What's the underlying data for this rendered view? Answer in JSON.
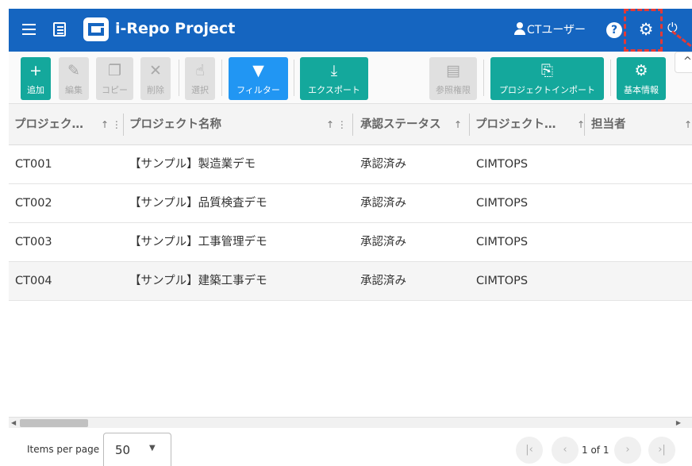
{
  "header": {
    "app_title": "i-Repo Project",
    "user_name": "CTユーザー",
    "help_label": "?",
    "colors": {
      "header_bg": "#1565c0",
      "highlight": "#e53935"
    }
  },
  "toolbar": {
    "add": "追加",
    "edit": "編集",
    "copy": "コピー",
    "delete": "削除",
    "select": "選択",
    "filter": "フィルター",
    "export": "エクスポート",
    "permissions": "参照権限",
    "project_import": "プロジェクトインポート",
    "basic_info": "基本情報",
    "colors": {
      "teal": "#14a89c",
      "blue": "#2196f3",
      "disabled": "#e0e0e0"
    }
  },
  "table": {
    "columns": [
      "プロジェク…",
      "プロジェクト名称",
      "承認ステータス",
      "プロジェクト…",
      "担当者"
    ],
    "rows": [
      [
        "CT001",
        "【サンプル】製造業デモ",
        "承認済み",
        "CIMTOPS",
        ""
      ],
      [
        "CT002",
        "【サンプル】品質検査デモ",
        "承認済み",
        "CIMTOPS",
        ""
      ],
      [
        "CT003",
        "【サンプル】工事管理デモ",
        "承認済み",
        "CIMTOPS",
        ""
      ],
      [
        "CT004",
        "【サンプル】建築工事デモ",
        "承認済み",
        "CIMTOPS",
        ""
      ]
    ]
  },
  "paginator": {
    "items_per_page_label": "Items per page",
    "items_per_page_value": "50",
    "range_label": "1 of 1"
  }
}
